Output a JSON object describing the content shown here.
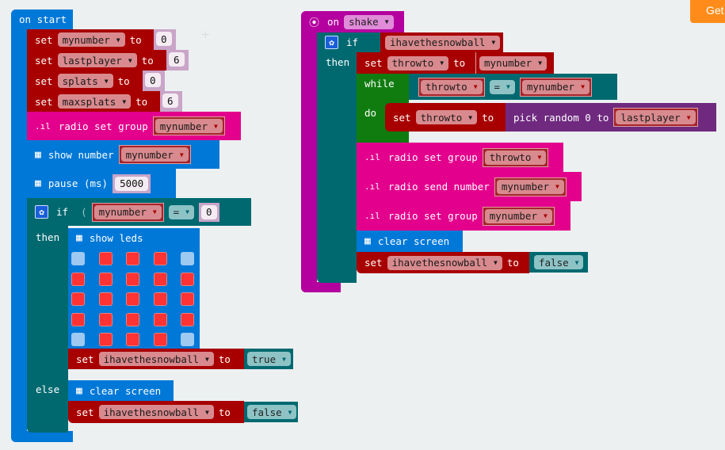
{
  "toolbar": {
    "get_started_label": "Get"
  },
  "on_start": {
    "label": "on start",
    "sets": [
      {
        "keyword": "set",
        "variable": "mynumber",
        "to": "to",
        "value": "0"
      },
      {
        "keyword": "set",
        "variable": "lastplayer",
        "to": "to",
        "value": "6"
      },
      {
        "keyword": "set",
        "variable": "splats",
        "to": "to",
        "value": "0"
      },
      {
        "keyword": "set",
        "variable": "maxsplats",
        "to": "to",
        "value": "6"
      }
    ],
    "radio_set_group": {
      "label": "radio set group",
      "variable": "mynumber"
    },
    "show_number": {
      "label": "show number",
      "variable": "mynumber"
    },
    "pause": {
      "label": "pause (ms)",
      "value": "5000"
    },
    "if_block": {
      "if_label": "if",
      "condition": {
        "variable": "mynumber",
        "operator": "=",
        "value": "0"
      },
      "then_label": "then",
      "show_leds": {
        "label": "show leds",
        "leds": [
          [
            0,
            1,
            1,
            1,
            0
          ],
          [
            1,
            1,
            1,
            1,
            1
          ],
          [
            1,
            1,
            1,
            1,
            1
          ],
          [
            1,
            1,
            1,
            1,
            1
          ],
          [
            0,
            1,
            1,
            1,
            0
          ]
        ]
      },
      "then_set": {
        "keyword": "set",
        "variable": "ihavethesnowball",
        "to": "to",
        "value": "true"
      },
      "else_label": "else",
      "else_clear": {
        "label": "clear screen"
      },
      "else_set": {
        "keyword": "set",
        "variable": "ihavethesnowball",
        "to": "to",
        "value": "false"
      }
    }
  },
  "on_shake": {
    "on_label": "on",
    "gesture": "shake",
    "if_label": "if",
    "condition_variable": "ihavethesnowball",
    "then_label": "then",
    "set_throwto": {
      "keyword": "set",
      "variable": "throwto",
      "to": "to",
      "value_variable": "mynumber"
    },
    "while_block": {
      "while_label": "while",
      "condition": {
        "left": "throwto",
        "operator": "=",
        "right": "mynumber"
      },
      "do_label": "do",
      "do_set": {
        "keyword": "set",
        "variable": "throwto",
        "to": "to",
        "random_label": "pick random 0 to",
        "random_max": "lastplayer"
      }
    },
    "radio_set_group_1": {
      "label": "radio set group",
      "variable": "throwto"
    },
    "radio_send_number": {
      "label": "radio send number",
      "variable": "mynumber"
    },
    "radio_set_group_2": {
      "label": "radio set group",
      "variable": "mynumber"
    },
    "clear_screen": {
      "label": "clear screen"
    },
    "final_set": {
      "keyword": "set",
      "variable": "ihavethesnowball",
      "to": "to",
      "value": "false"
    }
  }
}
